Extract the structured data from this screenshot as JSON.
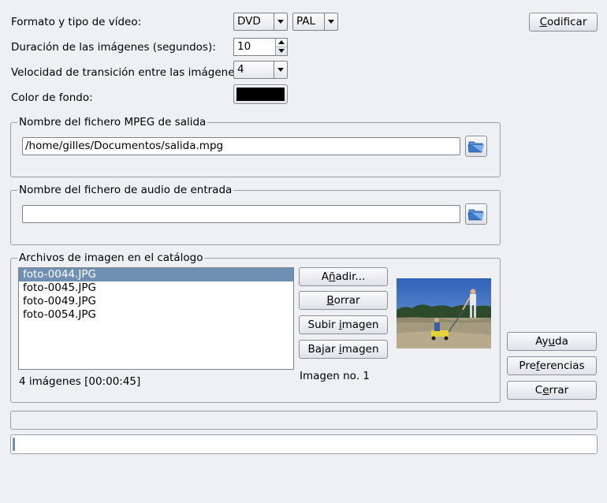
{
  "format": {
    "label": "Formato y tipo de vídeo:",
    "video_format": "DVD",
    "video_type": "PAL"
  },
  "duration": {
    "label": "Duración de las imágenes (segundos):",
    "value": "10"
  },
  "transition": {
    "label": "Velocidad de transición entre las imágenes:",
    "value": "4"
  },
  "background": {
    "label": "Color de fondo:",
    "color": "#000000"
  },
  "encode_button": {
    "label": "Codificar",
    "mnemonic": "C",
    "rest": "odificar"
  },
  "output_file": {
    "title": "Nombre del fichero MPEG de salida",
    "value": "/home/gilles/Documentos/salida.mpg",
    "browse_icon": "folder-open-icon"
  },
  "audio_file": {
    "title": "Nombre del fichero de audio de entrada",
    "value": "",
    "browse_icon": "folder-open-icon"
  },
  "catalog": {
    "title": "Archivos de imagen en el catálogo",
    "files": [
      "foto-0044.JPG",
      "foto-0045.JPG",
      "foto-0049.JPG",
      "foto-0054.JPG"
    ],
    "selected_index": 0,
    "summary": "4 imágenes [00:00:45]",
    "image_number": "Imagen no. 1",
    "buttons": {
      "add": {
        "pre": "A",
        "mn": "ñ",
        "post": "adir..."
      },
      "delete": {
        "pre": "",
        "mn": "B",
        "post": "orrar"
      },
      "up": {
        "pre": "Subir ",
        "mn": "i",
        "post": "magen"
      },
      "down": {
        "pre": "Bajar ",
        "mn": "i",
        "post": "magen"
      }
    }
  },
  "side_buttons": {
    "help": {
      "pre": "Ay",
      "mn": "u",
      "post": "da"
    },
    "prefs": {
      "pre": "Pre",
      "mn": "f",
      "post": "erencias"
    },
    "close": {
      "pre": "C",
      "mn": "e",
      "post": "rrar"
    }
  },
  "colors": {
    "selection": "#6f8fb3",
    "window_bg": "#eef0f4",
    "folder_icon": "#2f6fc0"
  }
}
